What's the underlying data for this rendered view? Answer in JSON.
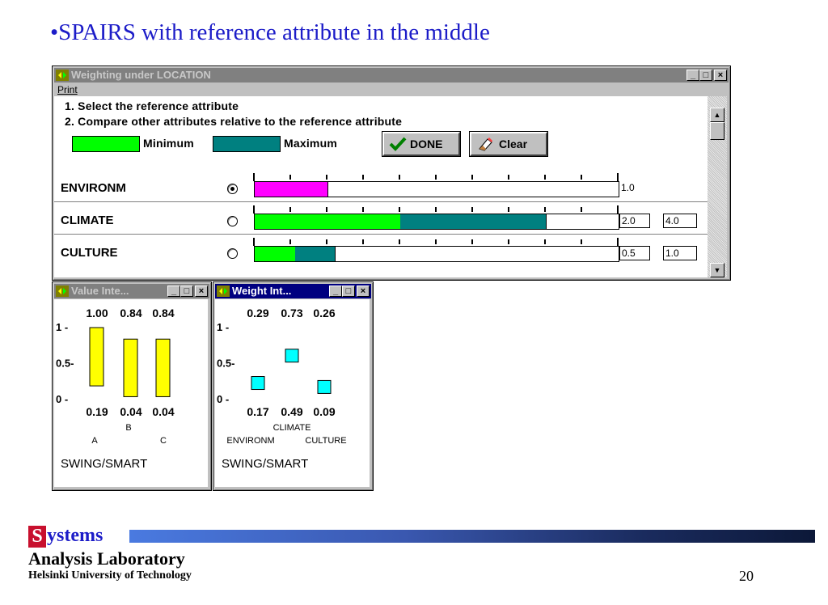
{
  "slide_title": "•SPAIRS with reference attribute in the middle",
  "main_window": {
    "title": "Weighting under LOCATION",
    "menu": [
      "Print"
    ],
    "instruction_1": "1. Select the reference attribute",
    "instruction_2": "2. Compare other attributes relative to the reference attribute",
    "legend_min": "Minimum",
    "legend_max": "Maximum",
    "done_label": "DONE",
    "clear_label": "Clear",
    "colors": {
      "minimum": "#00ff00",
      "maximum": "#008080",
      "reference": "#ff00ff"
    },
    "rows": [
      {
        "label": "ENVIRONM",
        "selected": true,
        "min_fraction": 0.2,
        "max_fraction": 0.2,
        "value1": "1.0",
        "value2": ""
      },
      {
        "label": "CLIMATE",
        "selected": false,
        "min_fraction": 0.4,
        "max_fraction": 0.8,
        "value1": "2.0",
        "value2": "4.0"
      },
      {
        "label": "CULTURE",
        "selected": false,
        "min_fraction": 0.11,
        "max_fraction": 0.22,
        "value1": "0.5",
        "value2": "1.0"
      }
    ]
  },
  "value_window": {
    "title": "Value Inte...",
    "chart_data": {
      "type": "bar",
      "categories": [
        "A",
        "B",
        "C"
      ],
      "upper_values": [
        1.0,
        0.84,
        0.84
      ],
      "lower_values": [
        0.19,
        0.04,
        0.04
      ],
      "upper_labels": [
        "1.00",
        "0.84",
        "0.84"
      ],
      "lower_labels": [
        "0.19",
        "0.04",
        "0.04"
      ],
      "y_ticks": [
        "1 -",
        "0.5-",
        "0 -"
      ],
      "ylim": [
        0,
        1
      ],
      "color": "#ffff00"
    },
    "method": "SWING/SMART"
  },
  "weight_window": {
    "title": "Weight Int...",
    "chart_data": {
      "type": "scatter",
      "categories": [
        "ENVIRONM",
        "CLIMATE",
        "CULTURE"
      ],
      "upper_values": [
        0.29,
        0.73,
        0.26
      ],
      "lower_values": [
        0.17,
        0.49,
        0.09
      ],
      "upper_labels": [
        "0.29",
        "0.73",
        "0.26"
      ],
      "lower_labels": [
        "0.17",
        "0.49",
        "0.09"
      ],
      "y_ticks": [
        "1 -",
        "0.5-",
        "0 -"
      ],
      "ylim": [
        0,
        1
      ],
      "color": "#00ffff"
    },
    "method": "SWING/SMART"
  },
  "footer": {
    "s_letter": "S",
    "systems_rest": "ystems",
    "line2": "Analysis Laboratory",
    "line3": "Helsinki University of Technology",
    "page_number": "20"
  }
}
